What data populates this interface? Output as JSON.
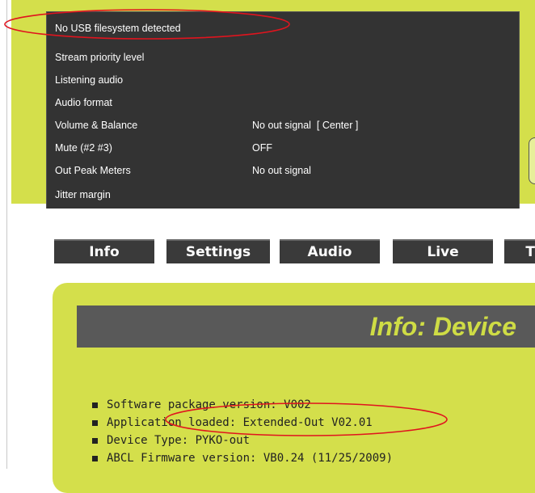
{
  "status_panel": {
    "rows": [
      {
        "label": "No USB filesystem detected",
        "value": ""
      },
      {
        "label": "Stream priority level",
        "value": ""
      },
      {
        "label": "Listening audio",
        "value": ""
      },
      {
        "label": "Audio format",
        "value": ""
      },
      {
        "label": "Volume & Balance",
        "value": "No out signal  [ Center ]"
      },
      {
        "label": "Mute (#2 #3)",
        "value": "OFF"
      },
      {
        "label": "Out Peak Meters",
        "value": "No out signal"
      },
      {
        "label": "Jitter margin",
        "value": ""
      }
    ]
  },
  "nav": {
    "tabs": [
      {
        "label": "Info"
      },
      {
        "label": "Settings"
      },
      {
        "label": "Audio"
      },
      {
        "label": "Live"
      },
      {
        "label": "T"
      }
    ]
  },
  "content": {
    "title": "Info: Device",
    "items": [
      "Software package version: V002",
      "Application loaded: Extended-Out V02.01",
      "Device Type: PYKO-out",
      "ABCL Firmware version: VB0.24 (11/25/2009)"
    ]
  },
  "colors": {
    "accent_yellow": "#d4df4b",
    "panel_dark": "#333333",
    "annotation_red": "#e0141e"
  }
}
